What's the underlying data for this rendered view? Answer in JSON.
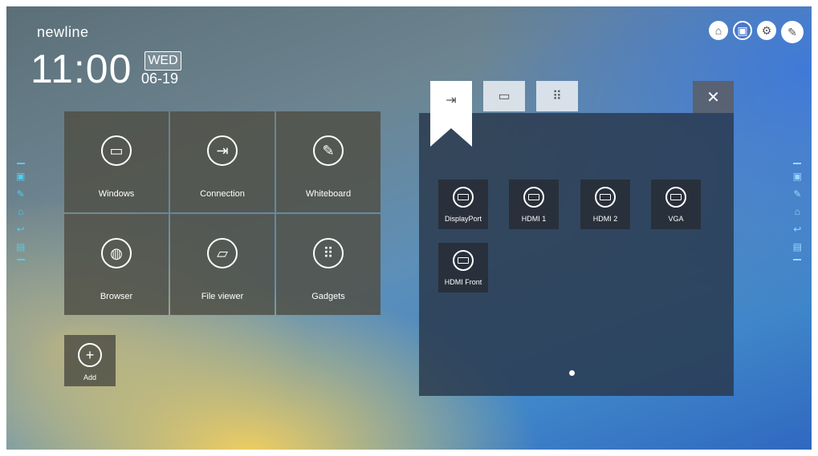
{
  "brand": "newline",
  "clock": {
    "time": "11:00",
    "day": "WED",
    "date": "06-19"
  },
  "top_icons": [
    "lock-icon",
    "monitor-icon",
    "gear-icon",
    "note-icon"
  ],
  "apps": [
    {
      "label": "Windows",
      "icon": "pc-icon",
      "glyph": "▭"
    },
    {
      "label": "Connection",
      "icon": "input-icon",
      "glyph": "⇥"
    },
    {
      "label": "Whiteboard",
      "icon": "pen-icon",
      "glyph": "✎"
    },
    {
      "label": "Browser",
      "icon": "globe-icon",
      "glyph": "◍"
    },
    {
      "label": "File viewer",
      "icon": "folder-icon",
      "glyph": "▱"
    },
    {
      "label": "Gadgets",
      "icon": "apps-grid-icon",
      "glyph": "⠿"
    }
  ],
  "add": {
    "label": "Add",
    "glyph": "+"
  },
  "source_panel": {
    "tabs": [
      {
        "name": "input-source",
        "glyph": "⇥"
      },
      {
        "name": "display",
        "glyph": "▭"
      },
      {
        "name": "apps",
        "glyph": "⠿"
      }
    ],
    "close_glyph": "✕",
    "sources": [
      "DisplayPort",
      "HDMI 1",
      "HDMI 2",
      "VGA",
      "HDMI Front"
    ]
  }
}
